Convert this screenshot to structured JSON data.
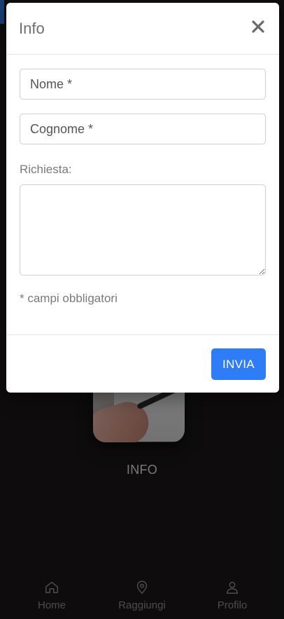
{
  "modal": {
    "title": "Info",
    "close_icon": "close-icon",
    "fields": {
      "nome_placeholder": "Nome *",
      "cognome_placeholder": "Cognome *",
      "richiesta_label": "Richiesta:",
      "richiesta_value": ""
    },
    "required_note": "* campi obbligatori",
    "submit_label": "INVIA"
  },
  "background": {
    "card_label": "INFO"
  },
  "bottom_nav": {
    "items": [
      {
        "label": "Home",
        "icon": "home-icon"
      },
      {
        "label": "Raggiungi",
        "icon": "location-pin-icon"
      },
      {
        "label": "Profilo",
        "icon": "user-icon"
      }
    ]
  },
  "colors": {
    "accent": "#2e7cf6",
    "background": "#1a1719",
    "modal": "#ffffff"
  }
}
